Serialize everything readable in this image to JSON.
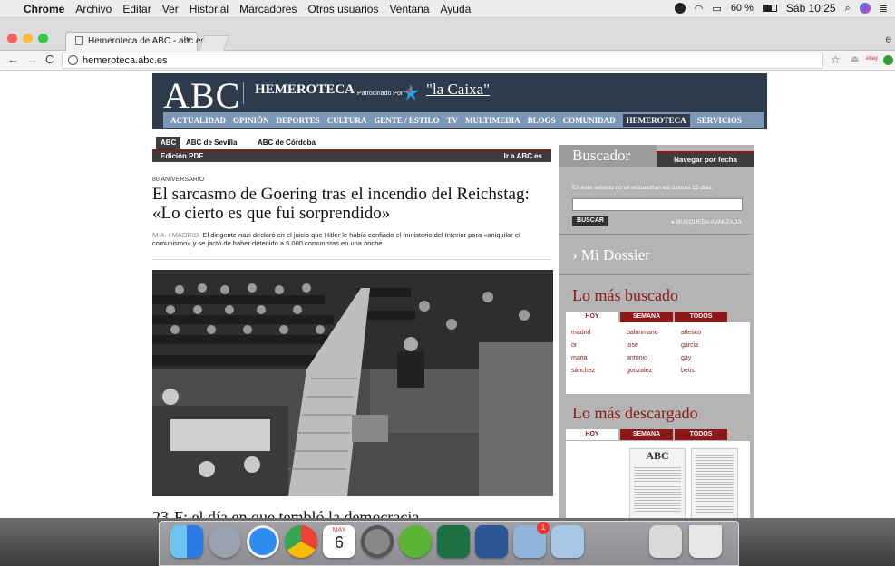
{
  "menubar": {
    "apple": "",
    "app": "Chrome",
    "items": [
      "Archivo",
      "Editar",
      "Ver",
      "Historial",
      "Marcadores",
      "Otros usuarios",
      "Ventana",
      "Ayuda"
    ],
    "battery": "60 %",
    "clock": "Sáb 10:25"
  },
  "browser": {
    "tab_title": "Hemeroteca de ABC - abc.es",
    "tab_close": "×",
    "url": "hemeroteca.abc.es"
  },
  "header": {
    "logo": "ABC",
    "section": "HEMEROTECA",
    "sponsor_prefix": "Patrocinado Por:",
    "sponsor": "\"la Caixa\"",
    "nav": [
      "ACTUALIDAD",
      "OPINIÓN",
      "DEPORTES",
      "CULTURA",
      "GENTE / ESTILO",
      "TV",
      "MULTIMEDIA",
      "BLOGS",
      "COMUNIDAD",
      "HEMEROTECA",
      "SERVICIOS"
    ],
    "nav_active": "HEMEROTECA"
  },
  "edition_tabs": [
    "ABC",
    "ABC de Sevilla",
    "ABC de Córdoba"
  ],
  "bar": {
    "left": "Edición PDF",
    "right": "Ir a ABC.es"
  },
  "article": {
    "kicker": "80 ANIVERSARIO",
    "headline": "El sarcasmo de Goering tras el incendio del Reichstag: «Lo cierto es que fui sorprendido»",
    "byline": "M.A. / MADRID.",
    "lede": "El dirigente nazi declaró en el juicio que Hitler le había confiado el ministerio del Interior para «aniquilar el comunismo» y se jactó de haber detenido a 5.000 comunistas en una noche"
  },
  "next_headline": "23-F: el día en que tembló la democracia",
  "sidebar": {
    "search_title": "Buscador",
    "browse_date": "Navegar por fecha",
    "search_note": "En este servicio no se encuentran los últimos 15 días.",
    "search_value": "",
    "search_button": "BUSCAR",
    "advanced": "▸ BUSQUEDA AVANZADA",
    "dossier": "› Mi Dossier",
    "most_searched": "Lo más buscado",
    "most_downloaded": "Lo más descargado",
    "period_tabs": [
      "HOY",
      "SEMANA",
      "TODOS"
    ],
    "terms": [
      "madrid",
      "balonmano",
      "atletico",
      "or",
      "jose",
      "garcia",
      "maria",
      "antonio",
      "gay",
      "sánchez",
      "gonzalez",
      "betis"
    ]
  },
  "dock": {
    "apps": [
      "finder",
      "launchpad",
      "safari",
      "chrome",
      "calendar",
      "system-preferences",
      "utorrent",
      "excel",
      "word",
      "mail",
      "preview",
      "files",
      "trash"
    ],
    "calendar_month": "MAY",
    "calendar_day": "6",
    "mail_badge": "1"
  }
}
